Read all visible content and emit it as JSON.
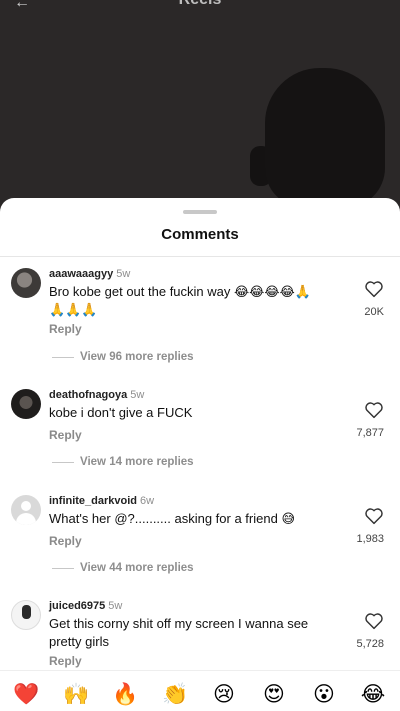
{
  "header": {
    "title": "Reels",
    "back_icon": "back-arrow-icon"
  },
  "sheet": {
    "title": "Comments"
  },
  "comments": [
    {
      "username": "aaawaaagyy",
      "age": "5w",
      "text_line1": "Bro kobe get out the fuckin way 😂😂😂😂🙏",
      "text_line2": "🙏🙏🙏",
      "reply": "Reply",
      "likes": "20K",
      "view_replies": "View 96 more replies"
    },
    {
      "username": "deathofnagoya",
      "age": "5w",
      "text_line1": "kobe i don't give a FUCK",
      "text_line2": "",
      "reply": "Reply",
      "likes": "7,877",
      "view_replies": "View 14 more replies"
    },
    {
      "username": "infinite_darkvoid",
      "age": "6w",
      "text_line1": "What's her @?.......... asking for a friend 😅",
      "text_line2": "",
      "reply": "Reply",
      "likes": "1,983",
      "view_replies": "View 44 more replies"
    },
    {
      "username": "juiced6975",
      "age": "5w",
      "text_line1": "Get this corny shit off my screen I wanna see",
      "text_line2": "pretty girls",
      "reply": "Reply",
      "likes": "5,728",
      "view_replies": ""
    }
  ],
  "emoji_bar": [
    "❤️",
    "🙌",
    "🔥",
    "👏",
    "😢",
    "😍",
    "😮",
    "😂"
  ],
  "colors": {
    "sheet_bg": "#ffffff",
    "muted": "#8e8e8e",
    "video_bg": "#2b2828"
  }
}
